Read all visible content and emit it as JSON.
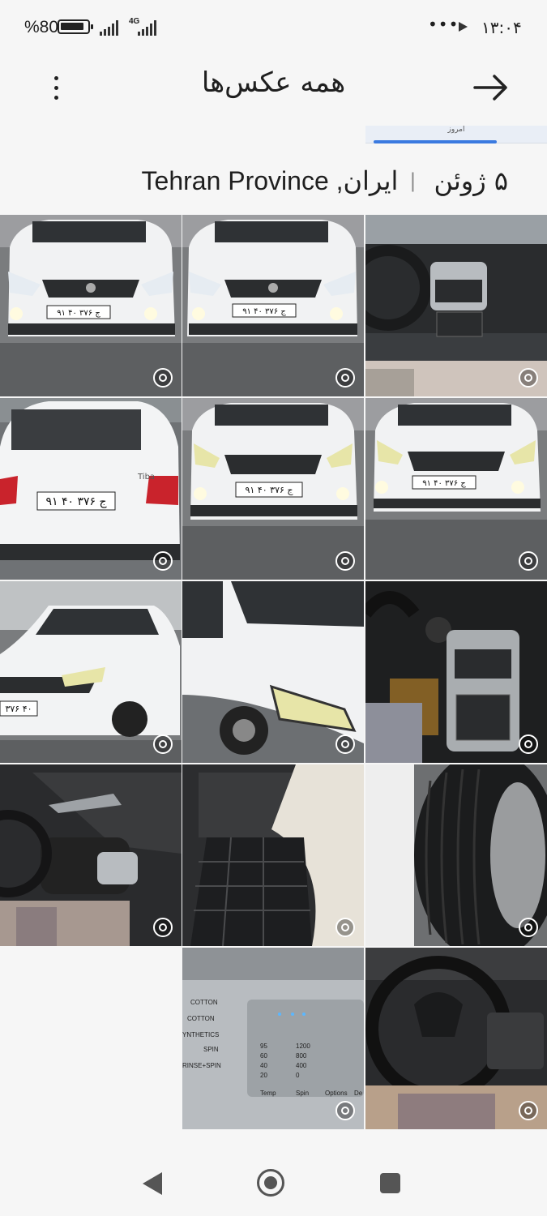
{
  "status_bar": {
    "battery_percent": "%80",
    "network_type": "4G",
    "time": "۱۳:۰۴",
    "overflow_dots": "•••"
  },
  "app_bar": {
    "title": "همه عکس‌ها"
  },
  "preview_strip": {
    "label": "امروز"
  },
  "section": {
    "date": "۵ ژوئن",
    "separator": "|",
    "location": "ایران, Tehran Province"
  },
  "photos": [
    {
      "subject": "car-front"
    },
    {
      "subject": "car-front"
    },
    {
      "subject": "car-dashboard"
    },
    {
      "subject": "car-rear",
      "plate": "۹۱ ج ۳۷۶ ۴۰",
      "badge": "Tiba"
    },
    {
      "subject": "car-front",
      "plate": "۹۱ ج ۳۷۶ ۴۰"
    },
    {
      "subject": "car-front",
      "plate": "۹۱ ج ۳۷۶ ۴۰"
    },
    {
      "subject": "car-side",
      "plate": "۳۷۶ ۴۰"
    },
    {
      "subject": "car-headlight"
    },
    {
      "subject": "car-console"
    },
    {
      "subject": "car-front-seat"
    },
    {
      "subject": "car-rear-seat"
    },
    {
      "subject": "car-tire"
    },
    {
      "subject": "washing-machine-panel"
    },
    {
      "subject": "steering-wheel"
    }
  ],
  "washer_panel": {
    "programs": [
      "COTTON",
      "COTTON",
      "YNTHETICS",
      "SPIN",
      "RINSE+SPIN"
    ],
    "temps": [
      "95",
      "60",
      "40",
      "20"
    ],
    "spins": [
      "1200",
      "800",
      "400",
      "0"
    ],
    "buttons": [
      "Temp",
      "Spin",
      "Options",
      "De"
    ]
  },
  "nav_bar": {
    "back": "back-triangle",
    "home": "home-circle",
    "recents": "recents-square"
  }
}
